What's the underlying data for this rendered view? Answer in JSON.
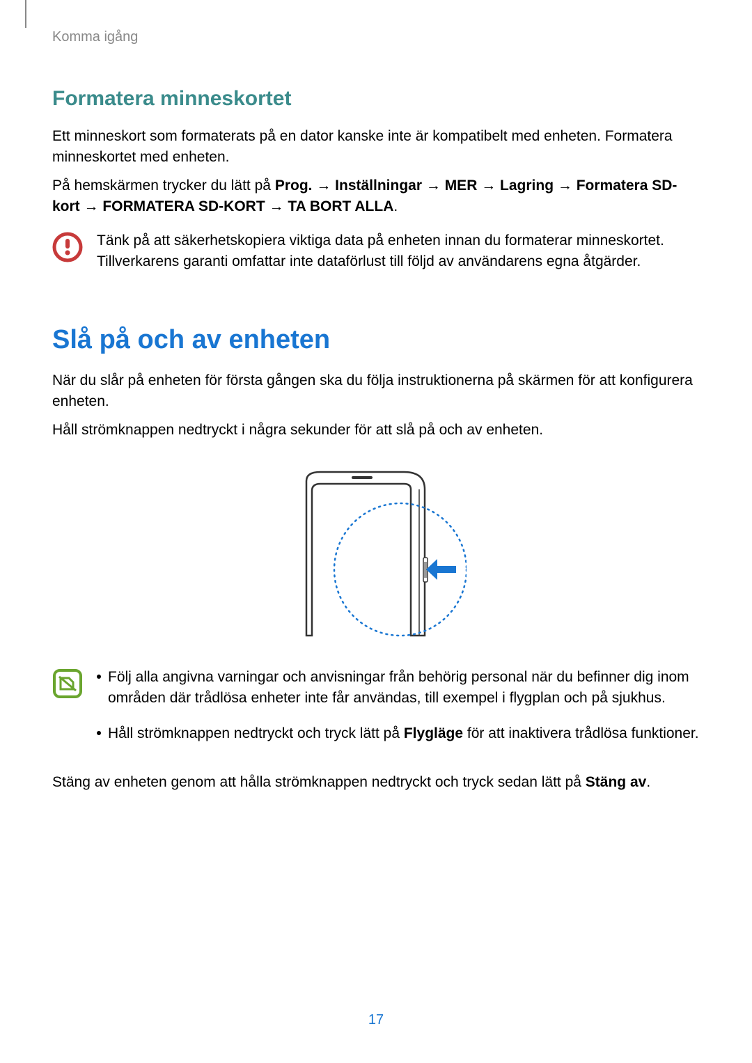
{
  "breadcrumb": "Komma igång",
  "section1": {
    "heading": "Formatera minneskortet",
    "p1": "Ett minneskort som formaterats på en dator kanske inte är kompatibelt med enheten. Formatera minneskortet med enheten.",
    "p2_pre": "På hemskärmen trycker du lätt på ",
    "p2_b1": "Prog.",
    "p2_arrow": " → ",
    "p2_b2": "Inställningar",
    "p2_b3": "MER",
    "p2_b4": "Lagring",
    "p2_b5": "Formatera SD-kort",
    "p2_b6": "FORMATERA SD-KORT",
    "p2_b7": "TA BORT ALLA",
    "p2_end": ".",
    "warning": "Tänk på att säkerhetskopiera viktiga data på enheten innan du formaterar minneskortet. Tillverkarens garanti omfattar inte dataförlust till följd av användarens egna åtgärder."
  },
  "section2": {
    "heading": "Slå på och av enheten",
    "p1": "När du slår på enheten för första gången ska du följa instruktionerna på skärmen för att konfigurera enheten.",
    "p2": "Håll strömknappen nedtryckt i några sekunder för att slå på och av enheten.",
    "tip1": "Följ alla angivna varningar och anvisningar från behörig personal när du befinner dig inom områden där trådlösa enheter inte får användas, till exempel i flygplan och på sjukhus.",
    "tip2_pre": "Håll strömknappen nedtryckt och tryck lätt på ",
    "tip2_b": "Flygläge",
    "tip2_post": " för att inaktivera trådlösa funktioner.",
    "p3_pre": "Stäng av enheten genom att hålla strömknappen nedtryckt och tryck sedan lätt på ",
    "p3_b": "Stäng av",
    "p3_post": "."
  },
  "pageNumber": "17"
}
